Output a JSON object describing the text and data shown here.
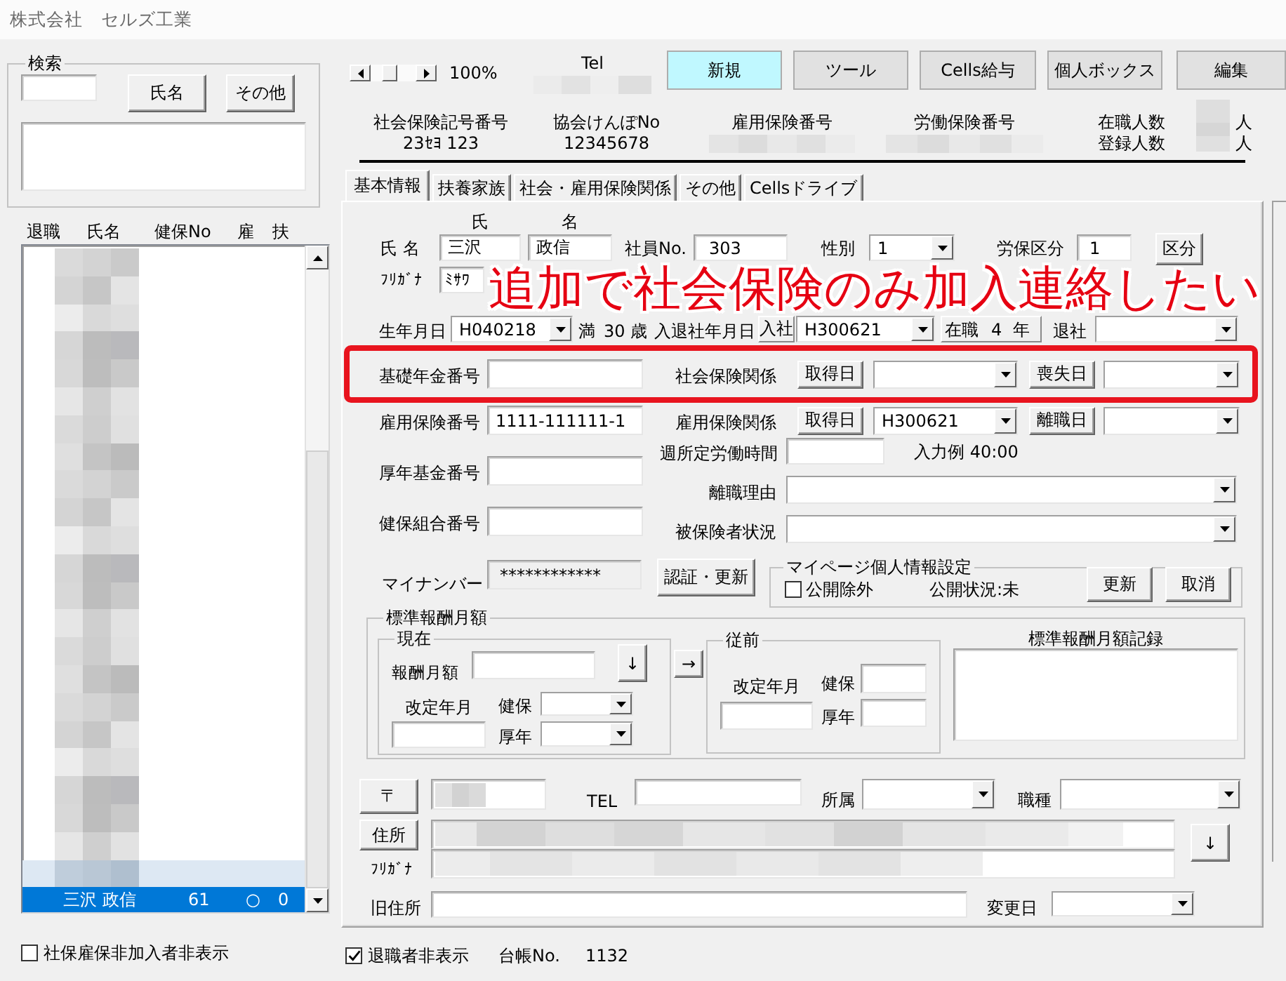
{
  "window": {
    "title": "株式会社　セルズ工業"
  },
  "search": {
    "title": "検索",
    "name_button": "氏名",
    "other_button": "その他"
  },
  "employee_list": {
    "columns": [
      "退職",
      "氏名",
      "健保No",
      "雇",
      "扶"
    ],
    "rows": [
      {
        "kind": "blurred",
        "selected": false,
        "highlighted": false
      },
      {
        "kind": "blurred",
        "selected": false,
        "highlighted": false
      },
      {
        "kind": "blurred",
        "selected": false,
        "highlighted": false
      },
      {
        "kind": "blurred",
        "selected": false,
        "highlighted": false
      },
      {
        "kind": "blurred",
        "selected": false,
        "highlighted": false
      },
      {
        "kind": "blurred",
        "selected": false,
        "highlighted": false
      },
      {
        "kind": "blurred",
        "selected": false,
        "highlighted": false
      },
      {
        "kind": "blurred",
        "selected": false,
        "highlighted": false
      },
      {
        "kind": "blurred",
        "selected": false,
        "highlighted": false
      },
      {
        "kind": "blurred",
        "selected": false,
        "highlighted": false
      },
      {
        "kind": "blurred",
        "selected": false,
        "highlighted": false
      },
      {
        "kind": "blurred",
        "selected": false,
        "highlighted": false
      },
      {
        "kind": "blurred",
        "selected": false,
        "highlighted": false
      },
      {
        "kind": "blurred",
        "selected": false,
        "highlighted": false
      },
      {
        "kind": "blurred",
        "selected": false,
        "highlighted": false
      },
      {
        "kind": "blurred",
        "selected": false,
        "highlighted": false
      },
      {
        "kind": "blurred",
        "selected": false,
        "highlighted": false
      },
      {
        "kind": "blurred",
        "selected": false,
        "highlighted": false
      },
      {
        "kind": "blurred",
        "selected": false,
        "highlighted": false
      },
      {
        "kind": "blurred",
        "selected": false,
        "highlighted": false
      },
      {
        "kind": "blurred",
        "selected": false,
        "highlighted": false
      },
      {
        "kind": "blurred",
        "selected": false,
        "highlighted": false
      },
      {
        "kind": "blurred",
        "selected": false,
        "highlighted": true
      },
      {
        "kind": "entry",
        "name": "三沢 政信",
        "health_no": "61",
        "employment": "○",
        "dependents": "0",
        "selected": true,
        "highlighted": false
      }
    ]
  },
  "hide_uninsured": {
    "label": "社保雇保非加入者非表示",
    "checked": false
  },
  "toolbar": {
    "zoom": "100%",
    "tel_label": "Tel",
    "buttons": [
      {
        "label": "新規",
        "active": true
      },
      {
        "label": "ツール",
        "active": false
      },
      {
        "label": "Cells給与",
        "active": false
      },
      {
        "label": "個人ボックス",
        "active": false
      },
      {
        "label": "編集",
        "active": false
      }
    ]
  },
  "summary": {
    "fields": [
      {
        "kind": "text",
        "label": "社会保険記号番号",
        "value": "23ｾﾖ 123"
      },
      {
        "kind": "text",
        "label": "協会けんぽNo",
        "value": "12345678"
      },
      {
        "kind": "blurred",
        "label": "雇用保険番号"
      },
      {
        "kind": "blurred",
        "label": "労働保険番号"
      }
    ],
    "counts": [
      {
        "label": "在職人数",
        "unit": "人"
      },
      {
        "label": "登録人数",
        "unit": "人"
      }
    ]
  },
  "tabs": [
    {
      "label": "基本情報",
      "selected": true
    },
    {
      "label": "扶養家族",
      "selected": false
    },
    {
      "label": "社会・雇用保険関係",
      "selected": false
    },
    {
      "label": "その他",
      "selected": false
    },
    {
      "label": "Cellsドライブ",
      "selected": false
    }
  ],
  "annotation": {
    "text": "追加で社会保険のみ加入連絡したい"
  },
  "form": {
    "name_headers": [
      "氏",
      "名"
    ],
    "name": {
      "label": "氏 名",
      "last": "三沢",
      "first": "政信"
    },
    "employee_no": {
      "label": "社員No.",
      "value": "303"
    },
    "gender": {
      "label": "性別",
      "value": "1"
    },
    "labor_class": {
      "label": "労保区分",
      "value": "1",
      "button": "区分"
    },
    "furigana": {
      "label": "ﾌﾘｶﾞﾅ",
      "value": "ﾐｻﾜ"
    },
    "birth": {
      "label": "生年月日",
      "value": "H040218",
      "age_prefix": "満",
      "age": "30",
      "age_suffix": "歳"
    },
    "hire": {
      "label": "入退社年月日",
      "join_label": "入社",
      "join_date": "H300621",
      "tenure_label": "在職",
      "tenure": "4",
      "tenure_unit": "年",
      "leave_label": "退社"
    },
    "pension_no": {
      "label": "基礎年金番号"
    },
    "social_insurance": {
      "label": "社会保険関係",
      "acquire_button": "取得日",
      "lose_button": "喪失日"
    },
    "employment_insurance_no": {
      "label": "雇用保険番号",
      "value": "1111-111111-1"
    },
    "employment_insurance": {
      "label": "雇用保険関係",
      "acquire_button": "取得日",
      "acquire_date": "H300621",
      "leave_button": "離職日"
    },
    "pension_fund_no": {
      "label": "厚年基金番号"
    },
    "health_union_no": {
      "label": "健保組合番号"
    },
    "weekly_hours": {
      "label": "週所定労働時間",
      "hint": "入力例 40:00"
    },
    "leave_reason": {
      "label": "離職理由"
    },
    "insured_status": {
      "label": "被保険者状況"
    },
    "my_number": {
      "label": "マイナンバー",
      "value": "************",
      "button": "認証・更新"
    },
    "mypage": {
      "title": "マイページ個人情報設定",
      "exclude": {
        "label": "公開除外",
        "checked": false
      },
      "status": "公開状況:未",
      "update_button": "更新",
      "cancel_button": "取消"
    },
    "standard_pay": {
      "title": "標準報酬月額",
      "current": {
        "title": "現在",
        "amount_label": "報酬月額",
        "down_button": "↓",
        "revision_label": "改定年月",
        "health_label": "健保",
        "pension_label": "厚年"
      },
      "copy_button": "→",
      "previous": {
        "title": "従前",
        "revision_label": "改定年月",
        "health_label": "健保",
        "pension_label": "厚年"
      },
      "history_label": "標準報酬月額記録"
    },
    "postal": {
      "button": "〒"
    },
    "tel": {
      "label": "TEL"
    },
    "department": {
      "label": "所属"
    },
    "job_type": {
      "label": "職種"
    },
    "address": {
      "button": "住所",
      "furigana_label": "ﾌﾘｶﾞﾅ",
      "copy_button": "↓"
    },
    "old_address": {
      "label": "旧住所"
    },
    "change_date": {
      "label": "変更日"
    }
  },
  "footer": {
    "hide_retired": {
      "label": "退職者非表示",
      "checked": true
    },
    "ledger_label": "台帳No.",
    "ledger_no": "1132"
  }
}
